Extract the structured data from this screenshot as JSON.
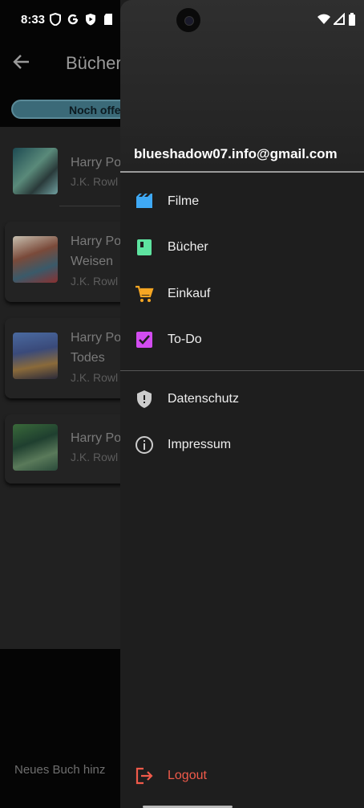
{
  "status_bar": {
    "time": "8:33"
  },
  "app_bar": {
    "title": "Bücher"
  },
  "tab": {
    "active_label": "Noch offen"
  },
  "books": [
    {
      "title_line1": "Harry Po",
      "title_line2": "",
      "author": "J.K. Rowl"
    },
    {
      "title_line1": "Harry Po",
      "title_line2": "Weisen",
      "author": "J.K. Rowl"
    },
    {
      "title_line1": "Harry Po",
      "title_line2": "Todes",
      "author": "J.K. Rowl"
    },
    {
      "title_line1": "Harry Po",
      "title_line2": "",
      "author": "J.K. Rowl"
    }
  ],
  "add_book_label": "Neues Buch hinz",
  "drawer": {
    "email": "blueshadow07.info@gmail.com",
    "menu": [
      {
        "label": "Filme",
        "icon": "movie-icon",
        "color": "#3fa9f5"
      },
      {
        "label": "Bücher",
        "icon": "book-icon",
        "color": "#5ee3a0"
      },
      {
        "label": "Einkauf",
        "icon": "cart-icon",
        "color": "#f5a623"
      },
      {
        "label": "To-Do",
        "icon": "checkbox-icon",
        "color": "#d24cf0"
      }
    ],
    "secondary": [
      {
        "label": "Datenschutz",
        "icon": "shield-icon"
      },
      {
        "label": "Impressum",
        "icon": "info-icon"
      }
    ],
    "logout": {
      "label": "Logout",
      "icon": "logout-icon",
      "color": "#f05a4a"
    }
  }
}
